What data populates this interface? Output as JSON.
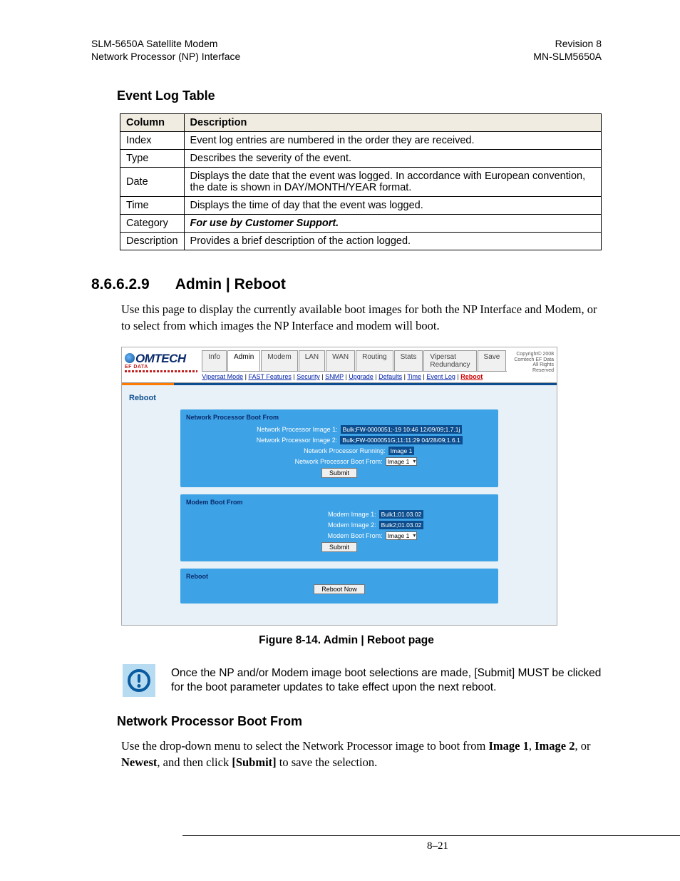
{
  "header": {
    "left1": "SLM-5650A Satellite Modem",
    "left2": "Network Processor (NP) Interface",
    "right1": "Revision 8",
    "right2": "MN-SLM5650A"
  },
  "event_log": {
    "title": "Event Log Table",
    "col1": "Column",
    "col2": "Description",
    "rows": [
      {
        "c": "Index",
        "d": "Event log entries are numbered in the order they are received."
      },
      {
        "c": "Type",
        "d": "Describes the severity of the event."
      },
      {
        "c": "Date",
        "d": "Displays the date that the event was logged. In accordance with European convention, the date is shown in DAY/MONTH/YEAR format."
      },
      {
        "c": "Time",
        "d": "Displays the time of day that the event was logged."
      },
      {
        "c": "Category",
        "d": "For use by Customer Support.",
        "ital": true
      },
      {
        "c": "Description",
        "d": "Provides a brief description of the action logged."
      }
    ]
  },
  "admin_reboot": {
    "num": "8.6.6.2.9",
    "title": "Admin | Reboot",
    "intro": "Use this page to display the currently available boot images for both the NP Interface and Modem, or to select from which images the NP Interface and modem will boot."
  },
  "screenshot": {
    "logo_main": "OMTECH",
    "logo_sub": "EF DATA",
    "copyright": "Copyright© 2008\nComtech EF Data\nAll Rights Reserved",
    "tabs": [
      "Info",
      "Admin",
      "Modem",
      "LAN",
      "WAN",
      "Routing",
      "Stats",
      "Vipersat Redundancy",
      "Save"
    ],
    "selected_tab": 1,
    "sublinks": [
      "Vipersat Mode",
      "FAST Features",
      "Security",
      "SNMP",
      "Upgrade",
      "Defaults",
      "Time",
      "Event Log",
      "Reboot"
    ],
    "page_title": "Reboot",
    "panel1": {
      "legend": "Network Processor Boot From",
      "img1_lbl": "Network Processor Image 1:",
      "img1_val": "Bulk;FW-0000051;-19 10:46 12/09/09;1.7.1j",
      "img2_lbl": "Network Processor Image 2:",
      "img2_val": "Bulk;FW-0000051G;11:11:29 04/28/09;1.6.1",
      "run_lbl": "Network Processor Running:",
      "run_val": "Image 1",
      "boot_lbl": "Network Processor Boot From:",
      "boot_sel": "Image 1",
      "submit": "Submit"
    },
    "panel2": {
      "legend": "Modem Boot From",
      "img1_lbl": "Modem Image 1:",
      "img1_val": "Bulk1;01.03.02",
      "img2_lbl": "Modem Image 2:",
      "img2_val": "Bulk2;01.03.02",
      "boot_lbl": "Modem Boot From:",
      "boot_sel": "Image 1",
      "submit": "Submit"
    },
    "panel3": {
      "legend": "Reboot",
      "btn": "Reboot Now"
    }
  },
  "figure_caption": "Figure 8-14. Admin | Reboot page",
  "note": "Once the NP and/or Modem image boot selections are made, [Submit] MUST be clicked for the boot parameter updates to take effect upon the next reboot.",
  "boot_from": {
    "title": "Network Processor Boot From",
    "p_pre": "Use the drop-down menu to select the Network Processor image to boot from ",
    "b1": "Image 1",
    "sep1": ", ",
    "b2": "Image 2",
    "sep2": ", or ",
    "b3": "Newest",
    "mid": ", and then click ",
    "b4": "[Submit]",
    "end": " to save the selection."
  },
  "footer": "8–21"
}
